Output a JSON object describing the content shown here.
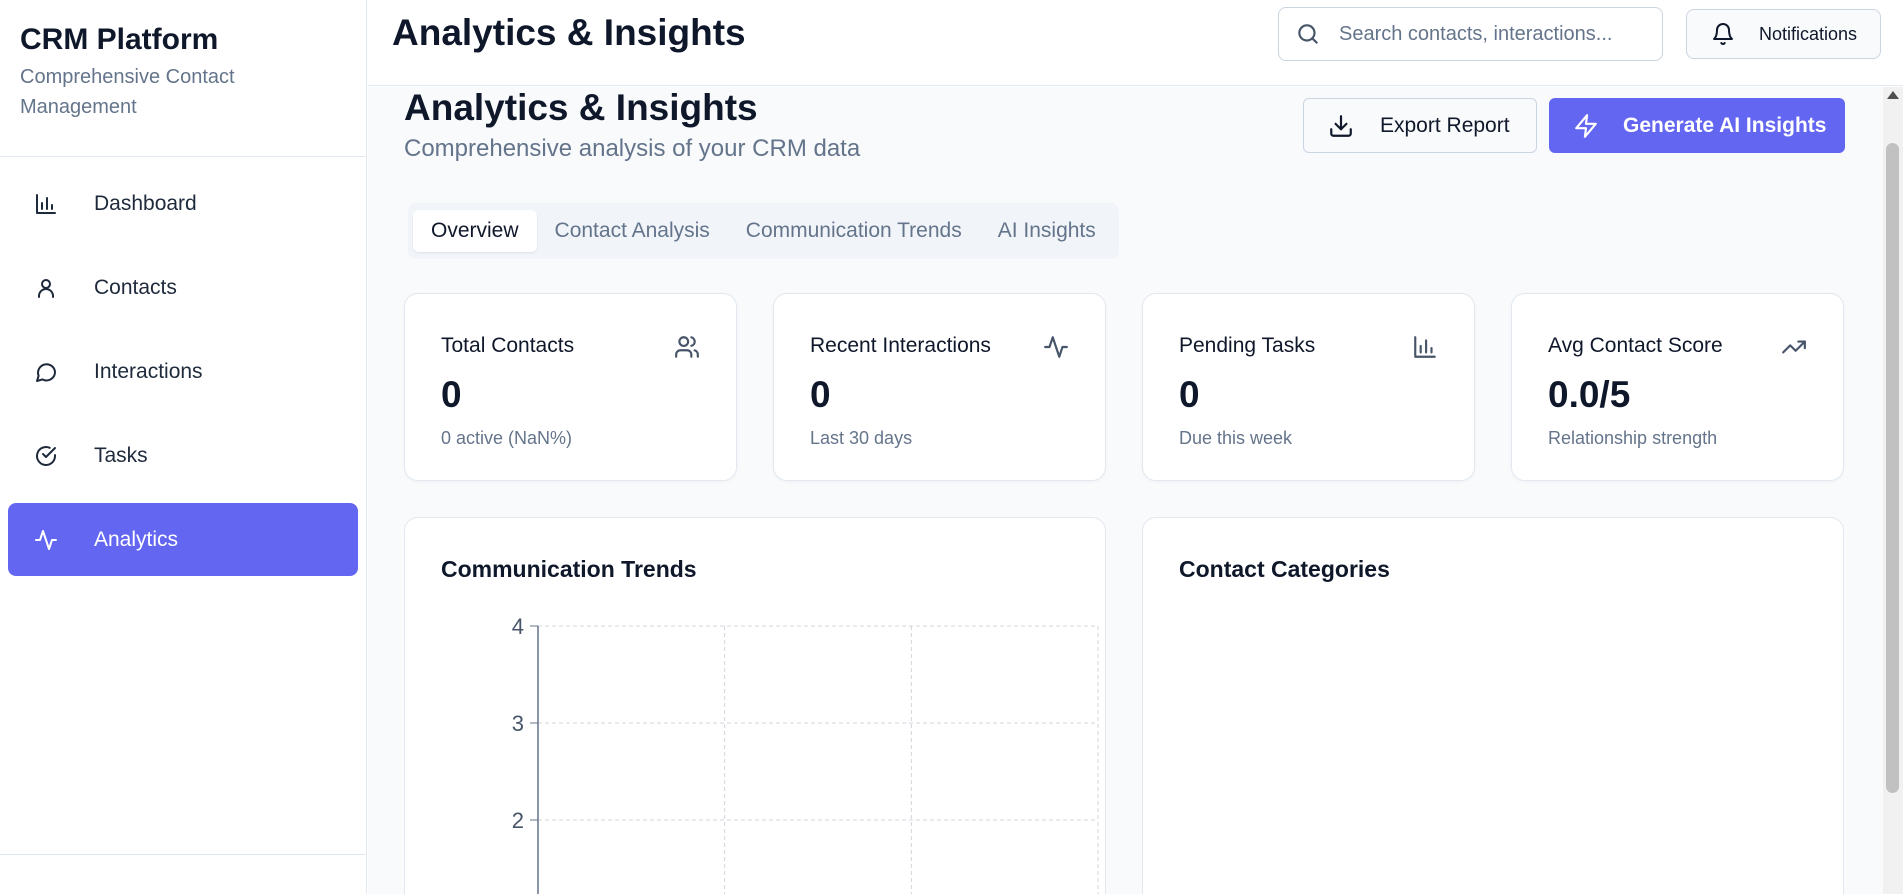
{
  "sidebar": {
    "title": "CRM Platform",
    "subtitle": "Comprehensive Contact Management",
    "items": [
      {
        "label": "Dashboard",
        "icon": "bar-chart-icon",
        "active": false
      },
      {
        "label": "Contacts",
        "icon": "user-icon",
        "active": false
      },
      {
        "label": "Interactions",
        "icon": "message-circle-icon",
        "active": false
      },
      {
        "label": "Tasks",
        "icon": "check-circle-icon",
        "active": false
      },
      {
        "label": "Analytics",
        "icon": "activity-icon",
        "active": true
      }
    ]
  },
  "header": {
    "title": "Analytics & Insights",
    "search_placeholder": "Search contacts, interactions...",
    "notifications_label": "Notifications"
  },
  "page": {
    "title": "Analytics & Insights",
    "subtitle": "Comprehensive analysis of your CRM data",
    "export_label": "Export Report",
    "ai_label": "Generate AI Insights",
    "accent_color": "#6366f1",
    "tabs": [
      {
        "label": "Overview",
        "active": true
      },
      {
        "label": "Contact Analysis",
        "active": false
      },
      {
        "label": "Communication Trends",
        "active": false
      },
      {
        "label": "AI Insights",
        "active": false
      }
    ]
  },
  "stats": [
    {
      "title": "Total Contacts",
      "value": "0",
      "sub": "0 active (NaN%)",
      "icon": "users-icon"
    },
    {
      "title": "Recent Interactions",
      "value": "0",
      "sub": "Last 30 days",
      "icon": "activity-icon"
    },
    {
      "title": "Pending Tasks",
      "value": "0",
      "sub": "Due this week",
      "icon": "bar-chart-icon"
    },
    {
      "title": "Avg Contact Score",
      "value": "0.0/5",
      "sub": "Relationship strength",
      "icon": "trending-up-icon"
    }
  ],
  "panels": {
    "trends_title": "Communication Trends",
    "categories_title": "Contact Categories"
  },
  "chart_data": {
    "type": "line",
    "title": "Communication Trends",
    "y_ticks": [
      4,
      3,
      2
    ],
    "ylim_visible": [
      2,
      4
    ],
    "grid": true,
    "series": []
  }
}
